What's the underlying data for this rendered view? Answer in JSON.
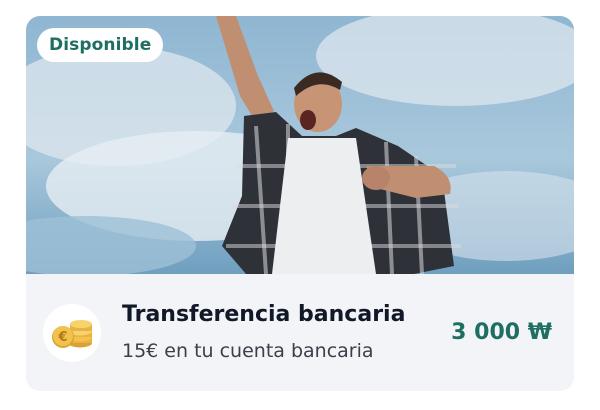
{
  "offer": {
    "status_badge": "Disponible",
    "title": "Transferencia bancaria",
    "subtitle": "15€ en tu cuenta bancaria",
    "price": "3 000 ₩"
  },
  "colors": {
    "accent": "#1f6e62",
    "card_background": "#f3f4f7",
    "badge_background": "#ffffff",
    "coin_gold": "#f2c14e"
  },
  "icons": {
    "product": "euro-coins-icon"
  }
}
